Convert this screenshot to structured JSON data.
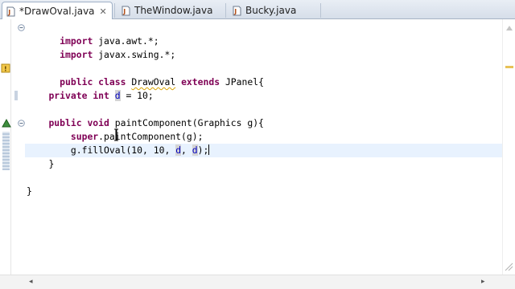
{
  "tabs": [
    {
      "label": "*DrawOval.java",
      "active": true,
      "close": "✕"
    },
    {
      "label": "TheWindow.java",
      "active": false
    },
    {
      "label": "Bucky.java",
      "active": false
    }
  ],
  "code_lines": [
    "import java.awt.*;",
    "import javax.swing.*;",
    "",
    "public class DrawOval extends JPanel{",
    "",
    "    private int d = 10;",
    "",
    "    public void paintComponent(Graphics g){",
    "        super.paintComponent(g);",
    "        g.fillOval(10, 10, d, d);",
    "    }",
    "",
    "}"
  ],
  "colors": {
    "keyword": "#7f0055",
    "field": "#0000c0",
    "current_line": "#e8f2fe",
    "tab_bar": "#d6dee9"
  },
  "icons": {
    "tab_file": "java-file-icon",
    "close": "close-icon",
    "fold_expanded": "fold-minus-icon",
    "warning": "warning-icon",
    "override": "override-triangle-icon",
    "scroll_left": "arrow-left-icon",
    "scroll_right": "arrow-right-icon",
    "overview_up": "arrow-up-icon"
  },
  "scroll_arrows": {
    "left": "◂",
    "right": "▸"
  }
}
